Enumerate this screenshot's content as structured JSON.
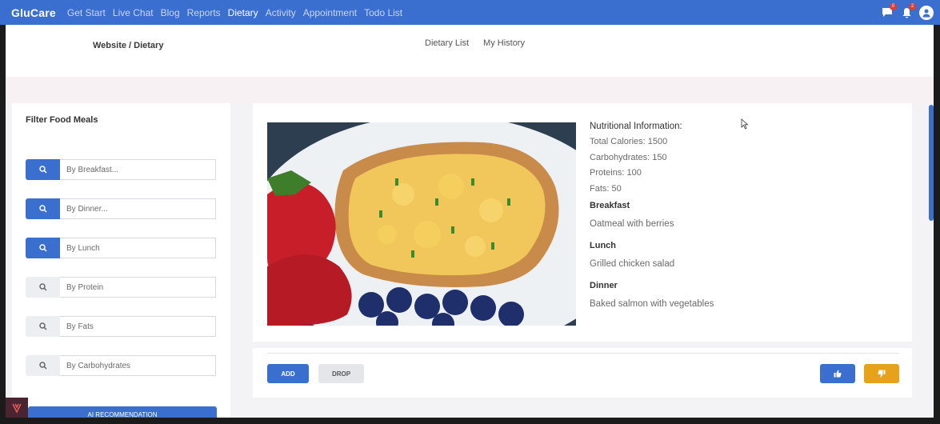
{
  "brand": "GluCare",
  "nav": {
    "items": [
      {
        "label": "Get Start"
      },
      {
        "label": "Live Chat"
      },
      {
        "label": "Blog"
      },
      {
        "label": "Reports"
      },
      {
        "label": "Dietary",
        "active": true
      },
      {
        "label": "Activity"
      },
      {
        "label": "Appointment"
      },
      {
        "label": "Todo List"
      }
    ],
    "icons": [
      {
        "name": "chat-icon",
        "badge": "0"
      },
      {
        "name": "bell-icon",
        "badge": "2"
      },
      {
        "name": "user-avatar-icon"
      }
    ]
  },
  "breadcrumb": "Website / Dietary",
  "tabs": [
    "Dietary List",
    "My History"
  ],
  "filter": {
    "title": "Filter Food Meals",
    "fields": [
      {
        "placeholder": "By Breakfast...",
        "active": true
      },
      {
        "placeholder": "By Dinner...",
        "active": true
      },
      {
        "placeholder": "By Lunch",
        "active": true
      },
      {
        "placeholder": "By Protein",
        "active": false
      },
      {
        "placeholder": "By Fats",
        "active": false
      },
      {
        "placeholder": "By Carbohydrates",
        "active": false
      }
    ],
    "recommend_label": "AI RECOMMENDATION"
  },
  "meal": {
    "image_alt": "Scrambled eggs on toast with strawberries and blueberries",
    "nutrition_title": "Nutritional Information:",
    "nutrition": [
      "Total Calories: 1500",
      "Carbohydrates: 150",
      "Proteins: 100",
      "Fats: 50"
    ],
    "breakfast_label": "Breakfast",
    "breakfast": "Oatmeal with berries",
    "lunch_label": "Lunch",
    "lunch": "Grilled chicken salad",
    "dinner_label": "Dinner",
    "dinner": "Baked salmon with vegetables"
  },
  "actions": {
    "add": "ADD",
    "drop": "DROP",
    "like_icon": "thumbs-up-icon",
    "dislike_icon": "thumbs-down-icon"
  },
  "colors": {
    "primary": "#3a6fd0",
    "warning": "#e6a21a"
  }
}
